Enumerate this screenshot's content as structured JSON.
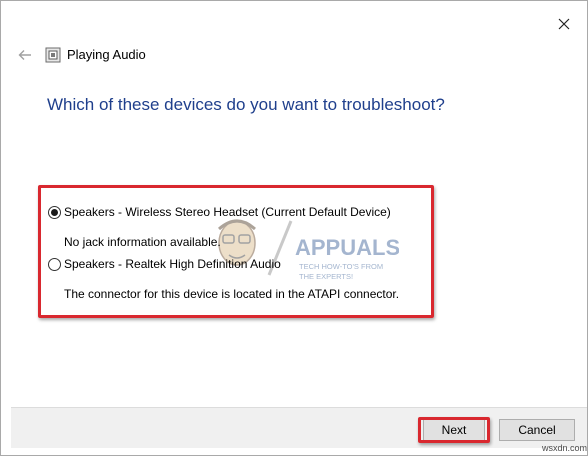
{
  "window": {
    "title": "Playing Audio",
    "heading": "Which of these devices do you want to troubleshoot?"
  },
  "options": [
    {
      "label": "Speakers - Wireless Stereo Headset (Current Default Device)",
      "description": "No jack information available.",
      "selected": true
    },
    {
      "label": "Speakers - Realtek High Definition Audio",
      "description": "The connector for this device is located in the ATAPI connector.",
      "selected": false
    }
  ],
  "watermark": {
    "brand": "APPUALS",
    "tagline_line1": "TECH HOW-TO'S FROM",
    "tagline_line2": "THE EXPERTS!"
  },
  "buttons": {
    "next_label": "Next",
    "cancel_label": "Cancel"
  },
  "site_tag": "wsxdn.com",
  "colors": {
    "heading": "#1f3f8c",
    "highlight": "#d9282f",
    "footer_bg": "#f0f0f0"
  },
  "icons": {
    "close": "close-icon",
    "back": "back-arrow-icon",
    "title": "troubleshooter-icon"
  }
}
